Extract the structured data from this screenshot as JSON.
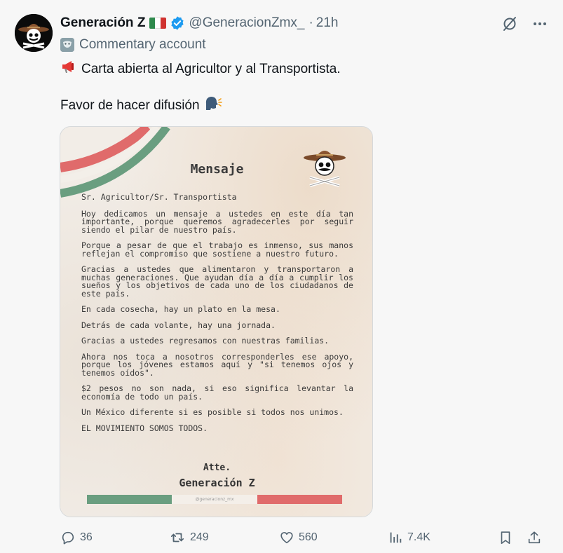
{
  "author": {
    "name": "Generación Z",
    "handle": "@GeneracionZmx_",
    "separator": "·",
    "time": "21h",
    "label": "Commentary account",
    "flag_colors": [
      "#2f8a4d",
      "#ffffff",
      "#d0322f"
    ],
    "verified_color": "#1d9bf0"
  },
  "tweet": {
    "line1": "Carta abierta al Agricultor y al Transportista.",
    "line2": "Favor de hacer difusión"
  },
  "image": {
    "title": "Mensaje",
    "paragraphs": [
      "Sr. Agricultor/Sr. Transportista",
      "Hoy dedicamos un mensaje a ustedes en este día tan importante, porque queremos agradecerles por seguir siendo el pilar de nuestro país.",
      "Porque a pesar de que el trabajo es inmenso, sus manos reflejan el compromiso que sostiene a nuestro futuro.",
      "Gracias a ustedes que alimentaron y transportaron a muchas generaciones. Que ayudan día a día a cumplir los sueños y los objetivos de cada uno de los ciudadanos de este país.",
      "En cada cosecha, hay un plato en la mesa.",
      "Detrás de cada volante, hay una jornada.",
      "Gracias a ustedes regresamos con nuestras familias.",
      "Ahora nos toca a nosotros corresponderles ese apoyo, porque los jóvenes estamos aquí y \"si tenemos ojos y tenemos oídos\".",
      "$2 pesos no son nada, si eso significa levantar la economía de todo un país.",
      "Un México diferente si es posible si todos nos unimos.",
      "EL MOVIMIENTO SOMOS TODOS."
    ],
    "signoff": "Atte.",
    "signature": "Generación Z",
    "watermark": "@generacionz_mx",
    "colors": {
      "green": "#6a9e80",
      "red": "#e06b6b"
    }
  },
  "actions": {
    "replies": "36",
    "reposts": "249",
    "likes": "560",
    "views": "7.4K",
    "repost_color": "#536471"
  },
  "icons": [
    "grok-icon",
    "more-icon",
    "reply-icon",
    "repost-icon",
    "like-icon",
    "views-icon",
    "bookmark-icon",
    "share-icon",
    "megaphone-icon",
    "speaking-head-icon",
    "mask-icon",
    "verified-icon"
  ]
}
